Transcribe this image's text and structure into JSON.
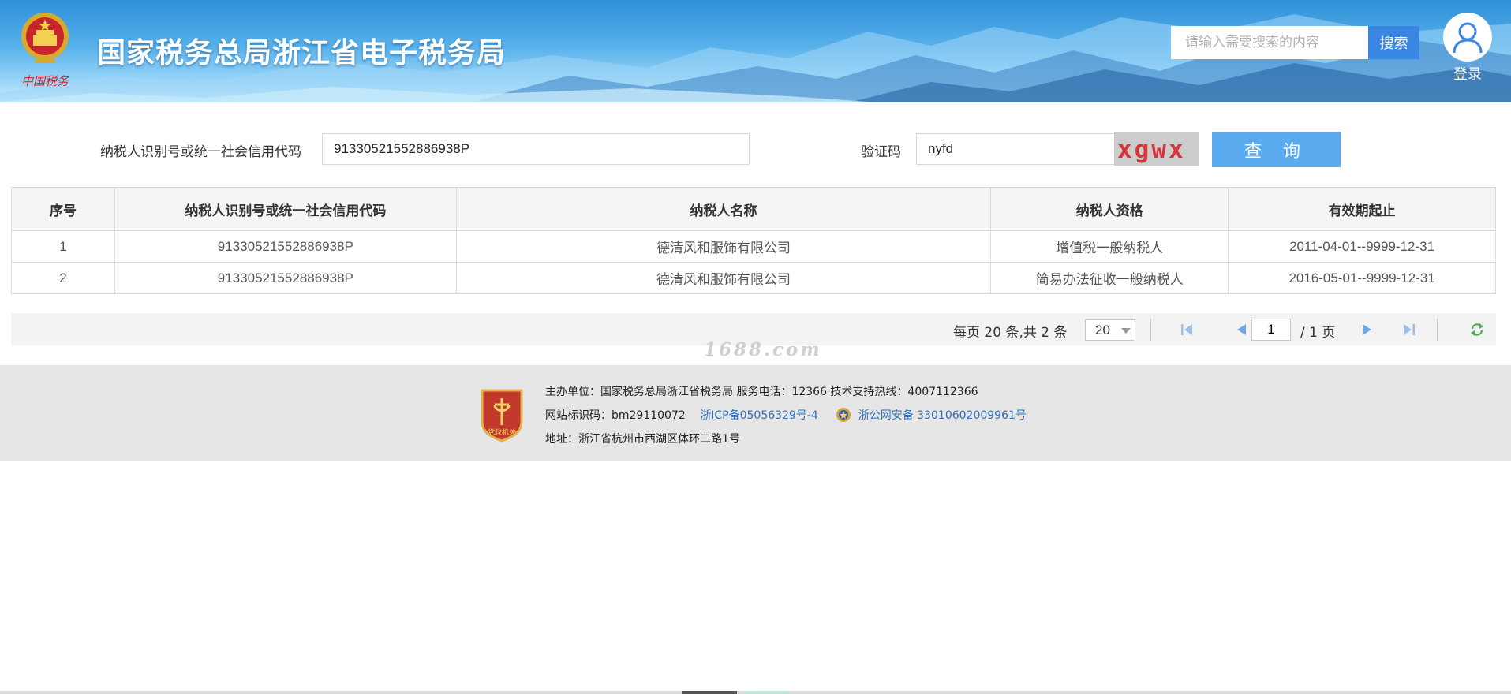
{
  "header": {
    "site_title": "国家税务总局浙江省电子税务局",
    "search_placeholder": "请输入需要搜索的内容",
    "search_button": "搜索",
    "login_label": "登录",
    "emblem_caption": "中国税务"
  },
  "query": {
    "taxpayer_id_label": "纳税人识别号或统一社会信用代码",
    "taxpayer_id_value": "91330521552886938P",
    "captcha_label": "验证码",
    "captcha_value": "nyfd",
    "captcha_image_text": "xgwx",
    "query_button": "查 询"
  },
  "table": {
    "columns": [
      "序号",
      "纳税人识别号或统一社会信用代码",
      "纳税人名称",
      "纳税人资格",
      "有效期起止"
    ],
    "rows": [
      [
        "1",
        "91330521552886938P",
        "德清风和服饰有限公司",
        "增值税一般纳税人",
        "2011-04-01--9999-12-31"
      ],
      [
        "2",
        "91330521552886938P",
        "德清风和服饰有限公司",
        "简易办法征收一般纳税人",
        "2016-05-01--9999-12-31"
      ]
    ]
  },
  "pager": {
    "info": "每页 20 条,共 2 条",
    "page_size": "20",
    "current_page": "1",
    "total_pages": "/ 1 页"
  },
  "watermark": "1688.com",
  "footer": {
    "badge_text": "党政机关",
    "line1": "主办单位：国家税务总局浙江省税务局     服务电话：12366     技术支持热线：4007112366",
    "site_id": "网站标识码：bm29110072",
    "icp": "浙ICP备05056329号-4",
    "police": "浙公网安备 33010602009961号",
    "address": "地址：浙江省杭州市西湖区体环二路1号"
  },
  "colors": {
    "header_blue": "#2f8fd8",
    "search_button": "#3a86e3",
    "query_button": "#5aaaf0",
    "captcha_text": "#d9343c",
    "link": "#2f6fb5",
    "footer_bg": "#e6e6e6"
  },
  "icons": [
    "national-emblem-icon",
    "user-avatar-icon",
    "first-page-icon",
    "prev-page-icon",
    "next-page-icon",
    "last-page-icon",
    "refresh-icon",
    "party-government-badge-icon",
    "police-badge-icon"
  ]
}
